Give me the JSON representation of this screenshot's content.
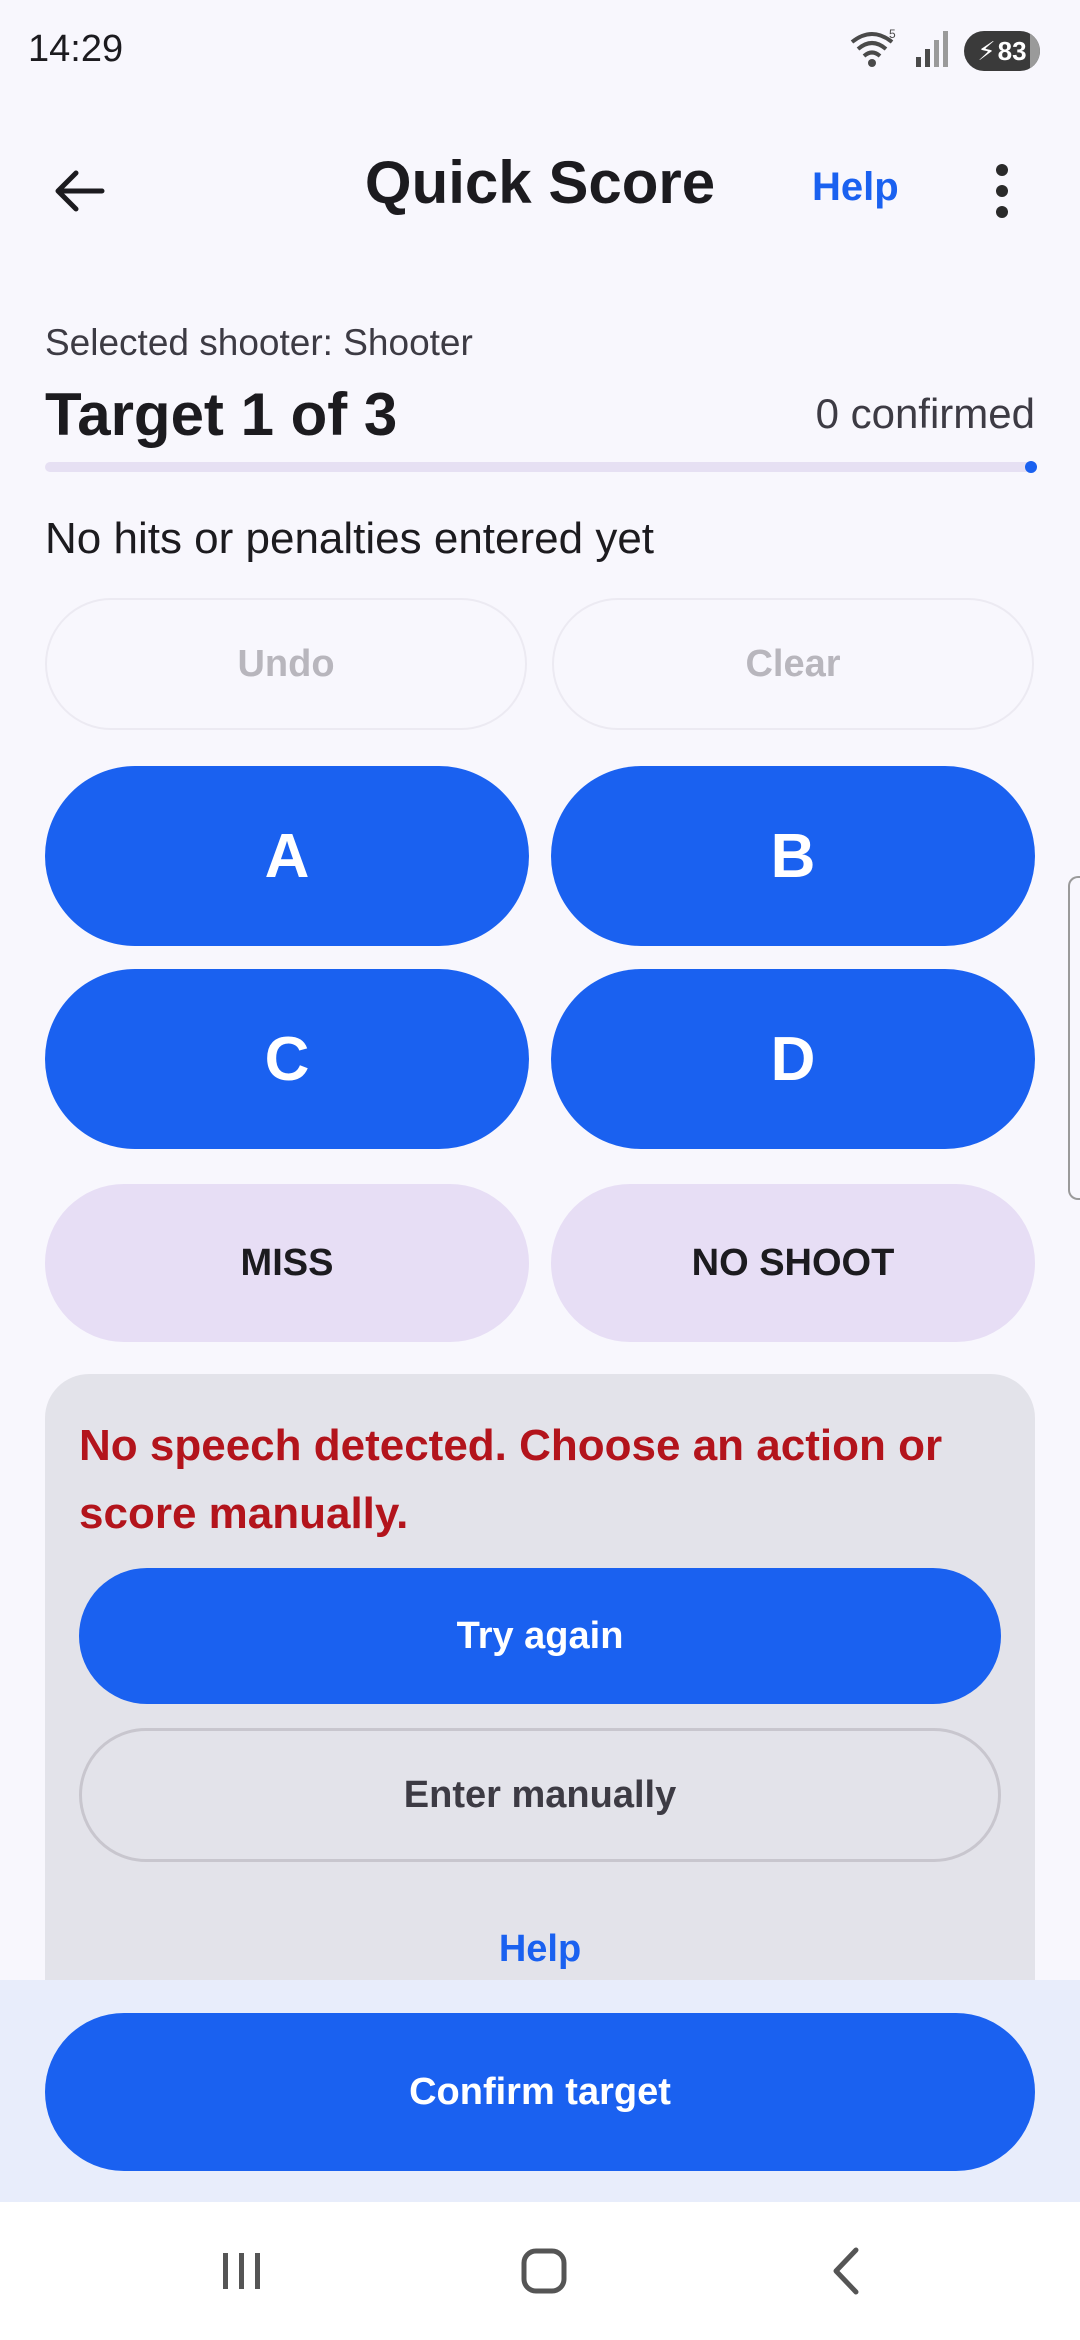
{
  "status_bar": {
    "time": "14:29",
    "battery": "83",
    "icons": [
      "wifi-icon",
      "signal-icon",
      "battery-charging-icon"
    ]
  },
  "app_bar": {
    "title": "Quick Score",
    "help_label": "Help",
    "back_icon": "arrow-back-icon",
    "more_icon": "more-vert-icon"
  },
  "target": {
    "selected_shooter": "Selected shooter: Shooter",
    "title": "Target 1 of 3",
    "confirmed": "0 confirmed",
    "status": "No hits or penalties entered yet"
  },
  "actions": {
    "undo": "Undo",
    "clear": "Clear"
  },
  "zones": {
    "a": "A",
    "b": "B",
    "c": "C",
    "d": "D",
    "miss": "MISS",
    "no_shoot": "NO SHOOT"
  },
  "speech": {
    "error": "No speech detected. Choose an action or score manually.",
    "try_again": "Try again",
    "enter_manually": "Enter manually",
    "help": "Help"
  },
  "footer": {
    "confirm": "Confirm target"
  },
  "colors": {
    "accent": "#1a61f0",
    "error": "#b3141c",
    "soft_button": "#e7def5",
    "panel": "#e3e3ea"
  }
}
